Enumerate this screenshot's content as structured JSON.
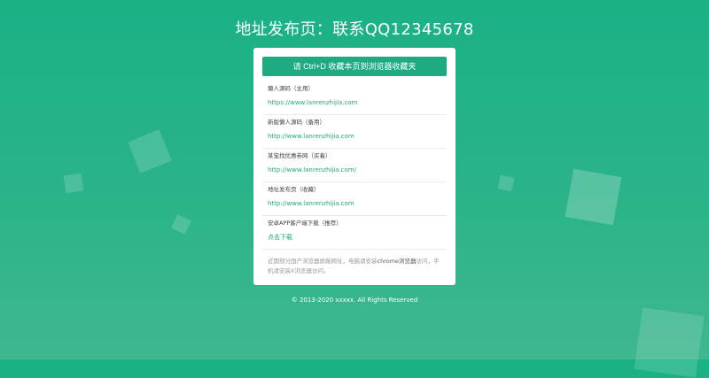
{
  "page": {
    "title": "地址发布页：联系QQ12345678"
  },
  "card": {
    "bookmark_button": "请 Ctrl+D 收藏本页到浏览器收藏夹",
    "links": [
      {
        "label": "懒人源码（主用）",
        "url": "https://www.lanrenzhijia.com"
      },
      {
        "label": "新版懒人源码（备用）",
        "url": "http://www.lanrenzhijia.com"
      },
      {
        "label": "某宝找优惠券网（买着）",
        "url": "http://www.lanrenzhijia.com/"
      },
      {
        "label": "地址发布页（收藏）",
        "url": "http://www.lanrenzhijia.com"
      },
      {
        "label": "安卓APP客户端下载（推荐）",
        "url": "点击下载"
      }
    ],
    "notice_part1": "近期部分国产浏览器屏蔽网址，电脑请安装",
    "notice_highlight": "chrome浏览器",
    "notice_part2": "访问，手机请安装X浏览器访问。"
  },
  "footer": {
    "copyright": "© 2013-2020 xxxxx. All Rights Reserved"
  }
}
